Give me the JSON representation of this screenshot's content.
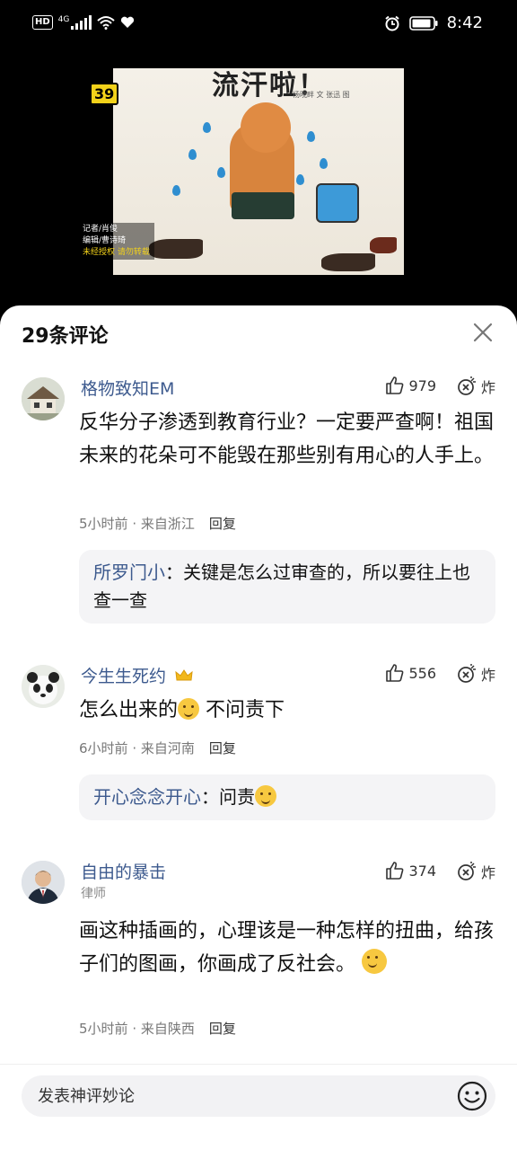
{
  "status_bar": {
    "hd": "HD",
    "network": "4G",
    "time": "8:42"
  },
  "video": {
    "title": "流汗啦！",
    "credit": "杨晓畔 文   张迅 图",
    "badge": "39",
    "watermark": [
      "记者/肖俊",
      "编辑/曹诗琦",
      "未经授权 请勿转载"
    ]
  },
  "comments_panel": {
    "title": "29条评论",
    "comments": [
      {
        "username": "格物致知EM",
        "tag": "",
        "likes": "979",
        "bomb_label": "炸",
        "text": "反华分子渗透到教育行业？一定要严查啊！祖国未来的花朵可不能毁在那些别有用心的人手上。",
        "time": "5小时前",
        "location": "来自浙江",
        "reply_label": "回复",
        "reply": {
          "user": "所罗门小",
          "text": "：关键是怎么过审查的，所以要往上也查一查"
        }
      },
      {
        "username": "今生生死约",
        "tag": "",
        "likes": "556",
        "bomb_label": "炸",
        "text_before": "怎么出来的",
        "text_after": " 不问责下",
        "time": "6小时前",
        "location": "来自河南",
        "reply_label": "回复",
        "reply": {
          "user": "开心念念开心",
          "text": "：问责"
        }
      },
      {
        "username": "自由的暴击",
        "tag": "律师",
        "likes": "374",
        "bomb_label": "炸",
        "text": "画这种插画的，心理该是一种怎样的扭曲，给孩子们的图画，你画成了反社会。",
        "time": "5小时前",
        "location": "来自陕西",
        "reply_label": "回复"
      }
    ],
    "input_placeholder": "发表神评妙论"
  },
  "colors": {
    "username": "#3d5a8e",
    "reply_bg": "#f4f4f6",
    "crown": "#f2b81c"
  }
}
